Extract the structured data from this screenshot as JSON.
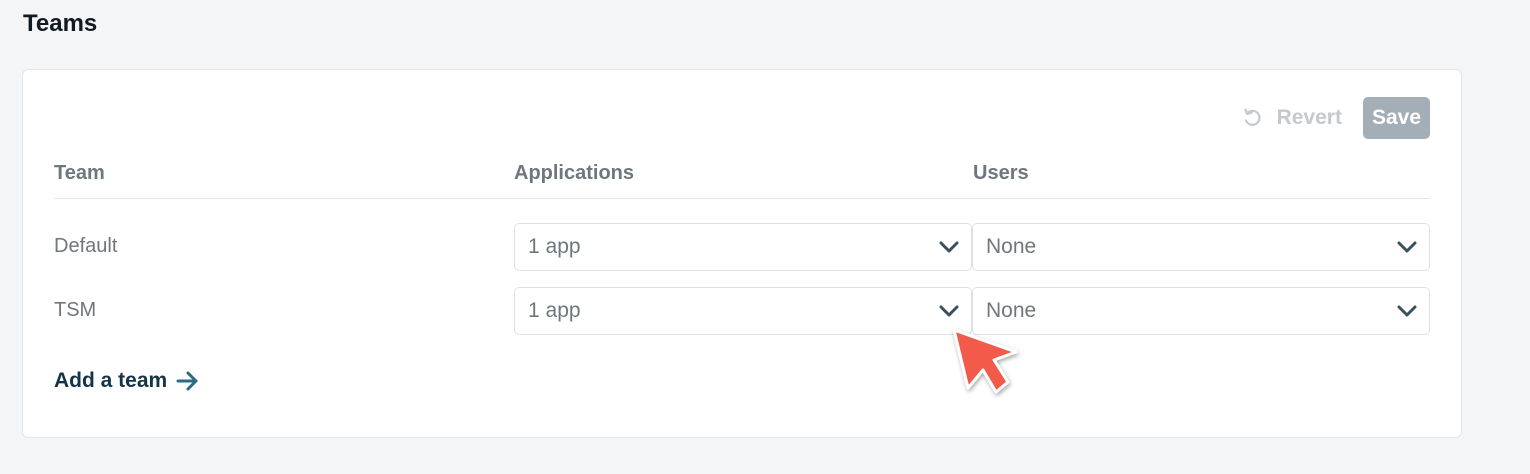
{
  "page": {
    "title": "Teams"
  },
  "toolbar": {
    "revert_label": "Revert",
    "save_label": "Save"
  },
  "table": {
    "columns": [
      "Team",
      "Applications",
      "Users"
    ],
    "rows": [
      {
        "team": "Default",
        "applications": "1 app",
        "users": "None"
      },
      {
        "team": "TSM",
        "applications": "1 app",
        "users": "None"
      }
    ]
  },
  "add_team": {
    "label": "Add a team"
  },
  "icons": {
    "revert": "revert-icon",
    "chevron": "chevron-down-icon",
    "arrow": "arrow-right-icon",
    "cursor": "mouse-cursor-icon"
  },
  "colors": {
    "background": "#f4f5f7",
    "card": "#ffffff",
    "save_button": "#a4aeb6",
    "link": "#153547",
    "link_arrow": "#2d6a85",
    "cursor": "#f25a4a"
  }
}
